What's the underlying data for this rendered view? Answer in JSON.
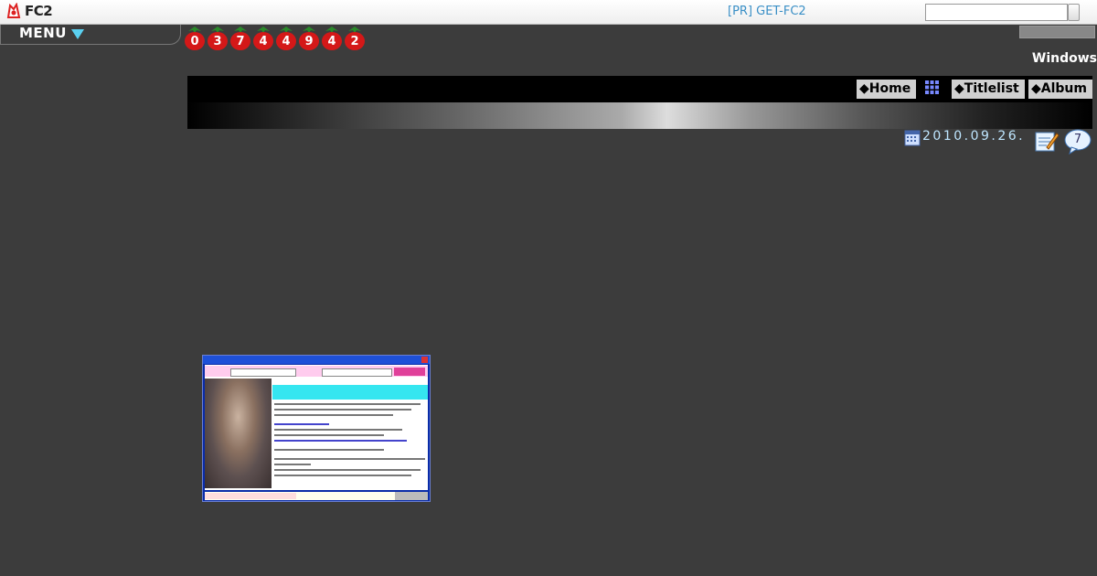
{
  "topbar": {
    "logo_text": "FC2",
    "pr_link": "[PR] GET-FC2",
    "search_value": "",
    "search_button_label": ""
  },
  "menu": {
    "label": "MENU"
  },
  "counter": {
    "digits": [
      "0",
      "3",
      "7",
      "4",
      "4",
      "9",
      "4",
      "2"
    ]
  },
  "blog": {
    "title_fragment": "Windows"
  },
  "nav": {
    "home": "◆Home",
    "titlelist": "◆Titlelist",
    "album": "◆Album"
  },
  "entry": {
    "date": "2010.09.26.",
    "comment_count": "7"
  },
  "colors": {
    "background": "#3c3c3c",
    "link": "#3a8fc6",
    "date": "#bfe6ff",
    "counter_berry": "#d41818"
  },
  "icons": [
    "fc2-logo-icon",
    "menu-arrow-icon",
    "grid-icon",
    "calendar-icon",
    "edit-icon",
    "comment-icon"
  ]
}
